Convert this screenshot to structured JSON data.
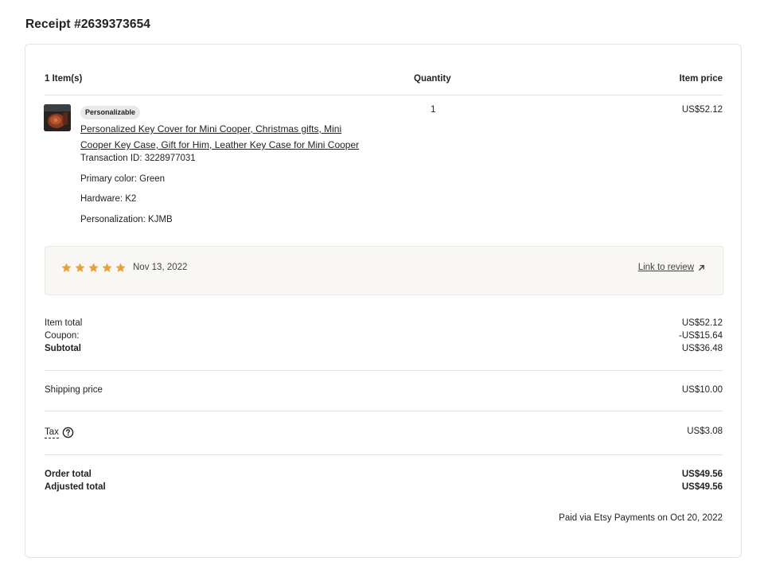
{
  "receipt": {
    "title": "Receipt #2639373654"
  },
  "table": {
    "col_items": "1 Item(s)",
    "col_quantity": "Quantity",
    "col_price": "Item price"
  },
  "item": {
    "badge": "Personalizable",
    "title": "Personalized Key Cover for Mini Cooper, Christmas gifts, Mini Cooper Key Case, Gift for Him, Leather Key Case for Mini Cooper",
    "transaction_id": "Transaction ID: 3228977031",
    "primary_color": "Primary color: Green",
    "hardware": "Hardware: K2",
    "personalization": "Personalization: KJMB",
    "quantity": "1",
    "price": "US$52.12",
    "thumbnail_icon": "product-thumbnail-image"
  },
  "review": {
    "rating": 5,
    "max_rating": 5,
    "star_color": "#e8a23a",
    "date": "Nov 13, 2022",
    "link_label": "Link to review",
    "link_icon": "external-arrow-icon"
  },
  "totals": {
    "item_total_label": "Item total",
    "item_total_value": "US$52.12",
    "coupon_label": "Coupon:",
    "coupon_value": "-US$15.64",
    "subtotal_label": "Subtotal",
    "subtotal_value": "US$36.48",
    "shipping_label": "Shipping price",
    "shipping_value": "US$10.00",
    "tax_label": "Tax",
    "tax_value": "US$3.08",
    "tax_icon": "help-icon",
    "order_total_label": "Order total",
    "order_total_value": "US$49.56",
    "adjusted_total_label": "Adjusted total",
    "adjusted_total_value": "US$49.56"
  },
  "payment": {
    "note": "Paid via Etsy Payments on Oct 20, 2022"
  }
}
